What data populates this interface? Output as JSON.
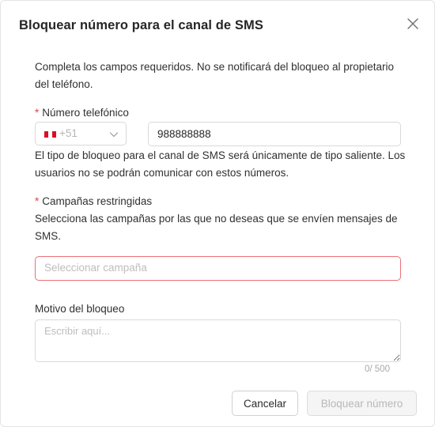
{
  "dialog": {
    "title": "Bloquear número para el canal de SMS",
    "description": "Completa los campos requeridos. No se notificará del bloqueo al propietario del teléfono."
  },
  "phone": {
    "required_mark": "*",
    "label": "Número telefónico",
    "country_flag": "peru-flag-icon",
    "country_code": "+51",
    "value": "988888888",
    "info": "El tipo de bloqueo para el canal de SMS será únicamente de tipo saliente. Los usuarios no se podrán comunicar con estos números."
  },
  "campaigns": {
    "required_mark": "*",
    "label": "Campañas restringidas",
    "description": "Selecciona las campañas por las que no deseas que se envíen mensajes de SMS.",
    "placeholder": "Seleccionar campaña",
    "error_border_color": "#ea6f76"
  },
  "reason": {
    "label": "Motivo del bloqueo",
    "placeholder": "Escribir aquí...",
    "counter": "0/ 500"
  },
  "actions": {
    "cancel_label": "Cancelar",
    "block_label": "Bloquear número",
    "block_disabled": true
  },
  "colors": {
    "required": "#e0434e",
    "error_border": "#ea6f76",
    "flag_red": "#d91023"
  }
}
